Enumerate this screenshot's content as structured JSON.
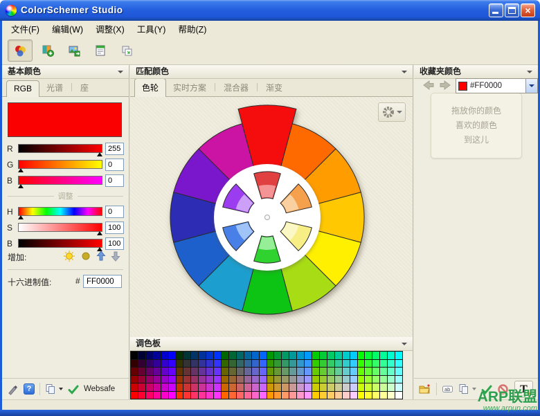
{
  "window": {
    "title": "ColorSchemer Studio"
  },
  "menu": {
    "items": [
      "文件(F)",
      "编辑(W)",
      "调整(X)",
      "工具(Y)",
      "帮助(Z)"
    ]
  },
  "toolbar": {
    "button_icons": [
      "color-wheel-icon",
      "palette-export-icon",
      "image-export-icon",
      "report-icon",
      "duplicate-icon"
    ],
    "active_button": 0,
    "color_combo": {
      "value": "#FF0000",
      "swatch_color": "#FF0000"
    }
  },
  "left_panel": {
    "header": "基本颜色",
    "tabs": [
      "RGB",
      "光谱",
      "座"
    ],
    "active_tab": "RGB",
    "preview_color": "#FA0000",
    "rgb_sliders": [
      {
        "label": "R",
        "value": 255,
        "max": 255,
        "stops": [
          "#000000",
          "#FF0000"
        ]
      },
      {
        "label": "G",
        "value": 0,
        "max": 255,
        "stops": [
          "#FF0000",
          "#FFFF00"
        ]
      },
      {
        "label": "B",
        "value": 0,
        "max": 255,
        "stops": [
          "#FF0000",
          "#FF00FF"
        ]
      }
    ],
    "adjust_label": "调整",
    "hsb_sliders": [
      {
        "label": "H",
        "value": 0,
        "max": 359,
        "stops": [
          "#FF0000",
          "#FFFF00",
          "#00FF00",
          "#00FFFF",
          "#0000FF",
          "#FF00FF",
          "#FF0000"
        ]
      },
      {
        "label": "S",
        "value": 100,
        "max": 100,
        "stops": [
          "#FFFFFF",
          "#FF0000"
        ]
      },
      {
        "label": "B",
        "value": 100,
        "max": 100,
        "stops": [
          "#000000",
          "#FF0000"
        ]
      }
    ],
    "increase_label": "增加:",
    "increase_icons": [
      "brighten-sun-icon",
      "darken-sun-icon",
      "saturate-up-arrow-icon",
      "desaturate-down-arrow-icon"
    ],
    "hex_label": "十六进制值:",
    "hex_prefix": "#",
    "hex_value": "FF0000",
    "bottom_icons": [
      "eyedropper-pencil-icon",
      "help-icon",
      "copy-icon",
      "websafe-check-icon"
    ],
    "websafe_label": "Websafe"
  },
  "center_panel": {
    "header": "匹配颜色",
    "tabs": [
      "色轮",
      "实时方案",
      "混合器",
      "渐变"
    ],
    "active_tab": "色轮",
    "scheme_button_icon": "scheme-wheel-icon",
    "palette_header": "调色板"
  },
  "right_panel": {
    "header": "收藏夹颜色",
    "drop_hint_lines": [
      "拖放你的颜色",
      "喜欢的颜色",
      "到这儿"
    ],
    "bottom_icons": [
      "open-folder-icon",
      "rename-ab-icon",
      "copy-icon",
      "check-icon",
      "block-icon",
      "text-tool-icon"
    ]
  },
  "wheel": {
    "selected_segment": 0,
    "outer_segments": [
      "#F50D0D",
      "#FF6A00",
      "#FF9C00",
      "#FFC800",
      "#FFF000",
      "#A8DC14",
      "#0DC414",
      "#1C9FCE",
      "#1D60CC",
      "#2C2CB4",
      "#7A16CC",
      "#CC14A4"
    ],
    "inner_wedges": [
      {
        "main": "#E04040",
        "light": "#F49494"
      },
      {
        "main": "#F5A04C",
        "light": "#FAD0A0"
      },
      {
        "main": "#F8EE86",
        "light": "#FCF8C6"
      },
      {
        "main": "#30D230",
        "light": "#96EE96"
      },
      {
        "main": "#4880E8",
        "light": "#A0C4F8"
      },
      {
        "main": "#9C3CF0",
        "light": "#CCA0F8"
      }
    ]
  },
  "palette": {
    "hex_steps": [
      "00",
      "33",
      "66",
      "99",
      "CC",
      "FF"
    ],
    "rows": 6,
    "cols": 36,
    "row_channel": "R",
    "col_major_channel": "G",
    "col_minor_channel": "B"
  },
  "watermark": {
    "line1": "ARP联盟",
    "line2": "www.arpun.com"
  }
}
